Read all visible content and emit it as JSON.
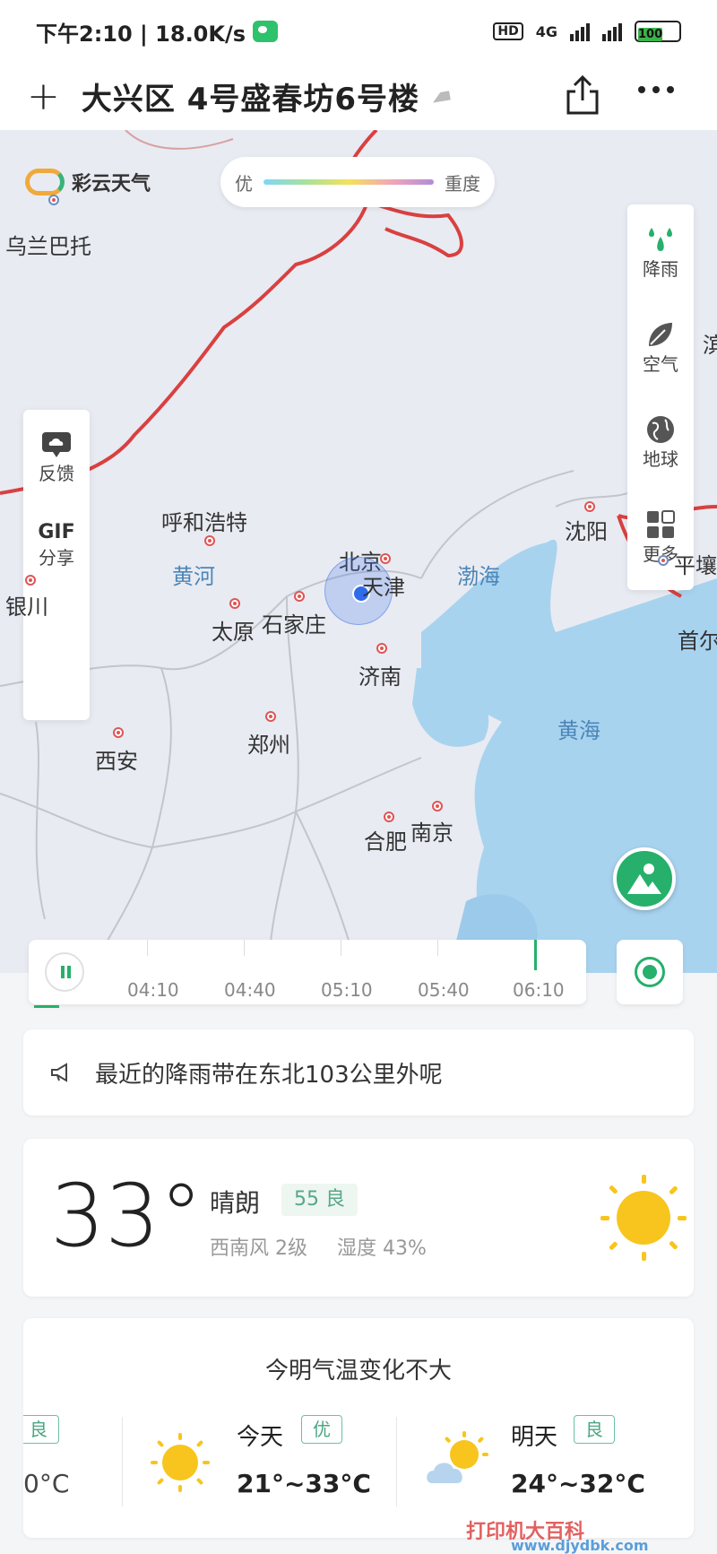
{
  "status_bar": {
    "time_speed": "下午2:10 | 18.0K/s",
    "hd": "HD",
    "network": "4G",
    "battery": "100"
  },
  "header": {
    "location_title": "大兴区 4号盛春坊6号楼",
    "add_icon": "plus-icon",
    "share_icon": "share-icon",
    "more_icon": "more-icon"
  },
  "map": {
    "brand_name": "彩云天气",
    "legend": {
      "low": "优",
      "high": "重度"
    },
    "right_panel": [
      {
        "label": "降雨",
        "icon": "rain-drops-icon"
      },
      {
        "label": "空气",
        "icon": "leaf-icon"
      },
      {
        "label": "地球",
        "icon": "globe-icon"
      },
      {
        "label": "更多",
        "icon": "grid-icon"
      }
    ],
    "left_panel": {
      "feedback_label": "反馈",
      "gif_label": "GIF",
      "share_label": "分享"
    },
    "labels": {
      "ulanbator": "乌兰巴托",
      "hohhot": "呼和浩特",
      "yellow_river": "黄河",
      "yinchuan": "银川",
      "beijing": "北京",
      "tianjin": "天津",
      "bohai": "渤海",
      "shenyang": "沈阳",
      "pyongyang": "平壤",
      "taiyuan": "太原",
      "shijiazhuang": "石家庄",
      "jinan": "济南",
      "seoul": "首尔",
      "xian": "西安",
      "zhengzhou": "郑州",
      "yellow_sea": "黄海",
      "hefei": "合肥",
      "nanjing": "南京",
      "harbin_part": "滨"
    }
  },
  "timeline": {
    "ticks": [
      "04:10",
      "04:40",
      "05:10",
      "05:40",
      "06:10"
    ]
  },
  "notice": {
    "text": "最近的降雨带在东北103公里外呢"
  },
  "current": {
    "temperature": "33°",
    "condition": "晴朗",
    "aqi": "55 良",
    "wind": "西南风 2级",
    "humidity": "湿度 43%"
  },
  "forecast": {
    "headline": "今明气温变化不大",
    "yesterday": {
      "aqi": "良",
      "range": "0°C"
    },
    "today": {
      "label": "今天",
      "aqi": "优",
      "range": "21°~33°C"
    },
    "tomorrow": {
      "label": "明天",
      "aqi": "良",
      "range": "24°~32°C"
    }
  },
  "watermark": {
    "title": "打印机大百科",
    "url": "www.djydbk.com"
  },
  "colors": {
    "accent": "#26b06b",
    "border_line": "#d94040",
    "sea": "#a8d3ef"
  }
}
